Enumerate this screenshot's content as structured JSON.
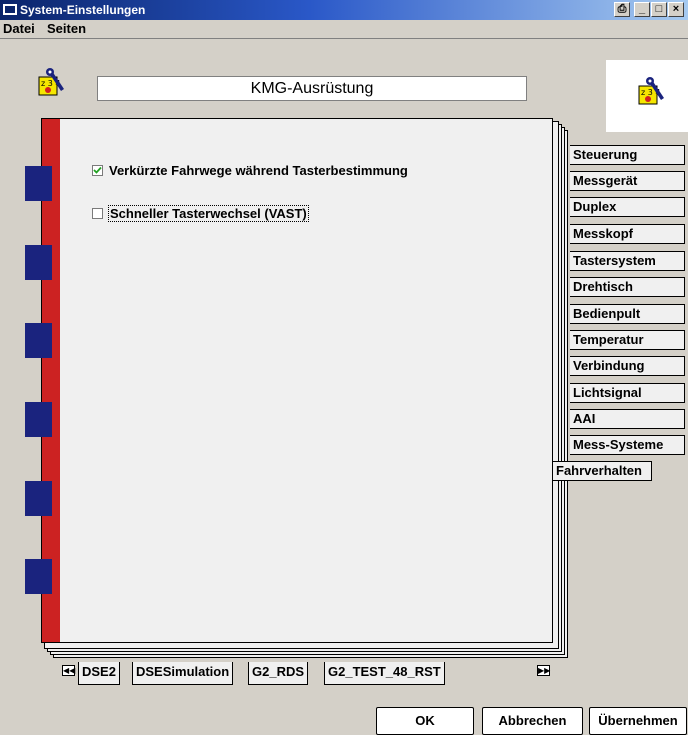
{
  "window": {
    "title": "System-Einstellungen"
  },
  "menu": [
    "Datei",
    "Seiten"
  ],
  "header": {
    "title": "KMG-Ausrüstung"
  },
  "options": [
    {
      "label": "Verkürzte Fahrwege während Tasterbestimmung",
      "checked": true
    },
    {
      "label": "Schneller Tasterwechsel (VAST)",
      "checked": false
    }
  ],
  "side_tabs": [
    "Steuerung",
    "Messgerät",
    "Duplex",
    "Messkopf",
    "Tastersystem",
    "Drehtisch",
    "Bedienpult",
    "Temperatur",
    "Verbindung",
    "Lichtsignal",
    "AAI",
    "Mess-Systeme"
  ],
  "active_tab": "Fahrverhalten",
  "bottom_tabs": [
    "DSE2",
    "DSESimulation",
    "G2_RDS",
    "G2_TEST_48_RST"
  ],
  "buttons": {
    "ok": "OK",
    "cancel": "Abbrechen",
    "apply": "Übernehmen"
  },
  "colors": {
    "spine": "#cc2222",
    "rings": "#1a237e",
    "titlebar": "#0a246a"
  }
}
